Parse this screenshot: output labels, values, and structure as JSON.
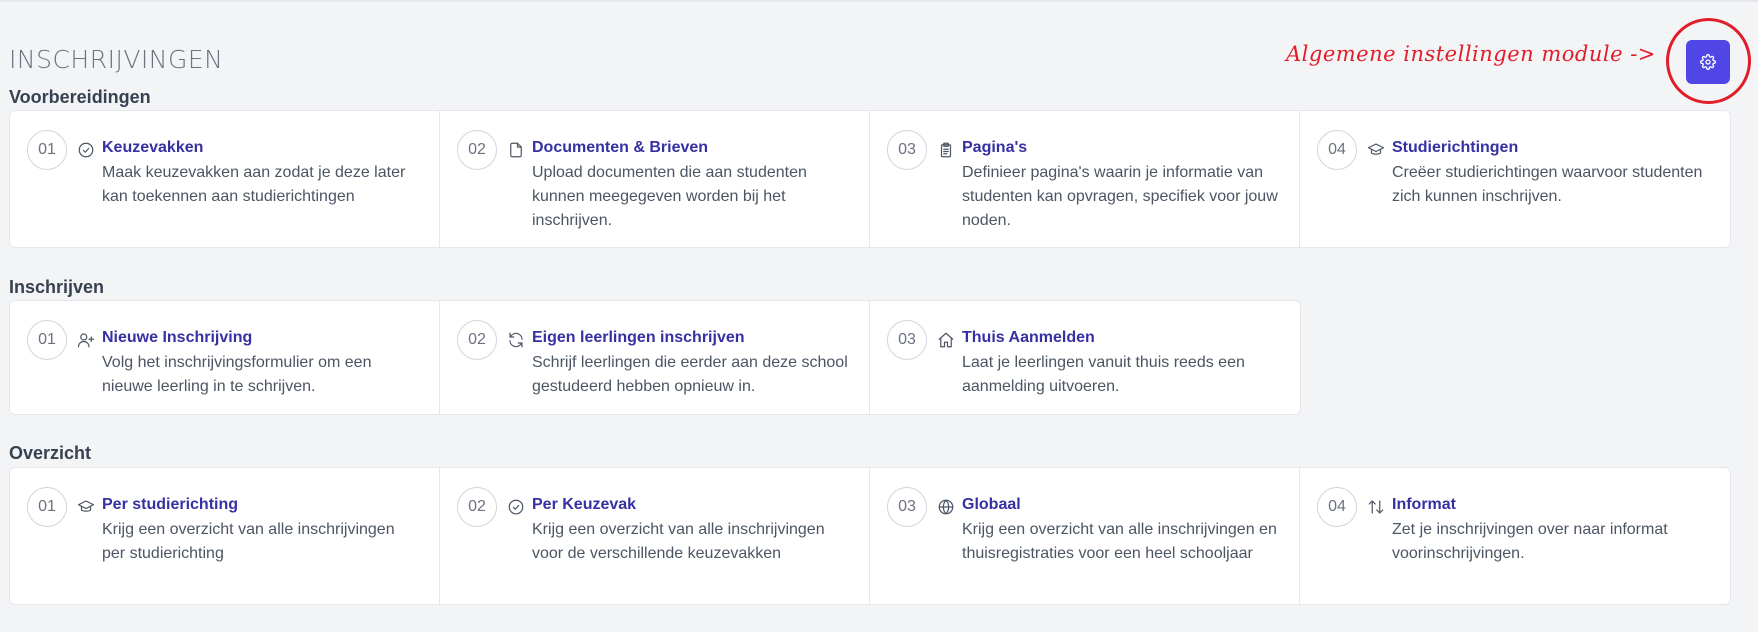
{
  "page": {
    "title": "INSCHRIJVINGEN"
  },
  "annotation": {
    "text": "Algemene instellingen module ->",
    "color": "#e11d2a"
  },
  "settings_button": {
    "icon": "gear-icon",
    "color": "#4f46e5"
  },
  "sections": [
    {
      "heading": "Voorbereidingen",
      "cards": [
        {
          "number": "01",
          "icon": "check-circle-icon",
          "title": "Keuzevakken",
          "description": "Maak keuzevakken aan zodat je deze later kan toekennen aan studierichtingen"
        },
        {
          "number": "02",
          "icon": "document-icon",
          "title": "Documenten & Brieven",
          "description": "Upload documenten die aan studenten kunnen meegegeven worden bij het inschrijven."
        },
        {
          "number": "03",
          "icon": "clipboard-icon",
          "title": "Pagina's",
          "description": "Definieer pagina's waarin je informatie van studenten kan opvragen, specifiek voor jouw noden."
        },
        {
          "number": "04",
          "icon": "graduation-cap-icon",
          "title": "Studierichtingen",
          "description": "Creëer studierichtingen waarvoor studenten zich kunnen inschrijven."
        }
      ]
    },
    {
      "heading": "Inschrijven",
      "cards": [
        {
          "number": "01",
          "icon": "user-plus-icon",
          "title": "Nieuwe Inschrijving",
          "description": "Volg het inschrijvingsformulier om een nieuwe leerling in te schrijven."
        },
        {
          "number": "02",
          "icon": "refresh-icon",
          "title": "Eigen leerlingen inschrijven",
          "description": "Schrijf leerlingen die eerder aan deze school gestudeerd hebben opnieuw in."
        },
        {
          "number": "03",
          "icon": "home-icon",
          "title": "Thuis Aanmelden",
          "description": "Laat je leerlingen vanuit thuis reeds een aanmelding uitvoeren."
        }
      ]
    },
    {
      "heading": "Overzicht",
      "cards": [
        {
          "number": "01",
          "icon": "graduation-cap-icon",
          "title": "Per studierichting",
          "description": "Krijg een overzicht van alle inschrijvingen per studierichting"
        },
        {
          "number": "02",
          "icon": "check-circle-icon",
          "title": "Per Keuzevak",
          "description": "Krijg een overzicht van alle inschrijvingen voor de verschillende keuzevakken"
        },
        {
          "number": "03",
          "icon": "globe-icon",
          "title": "Globaal",
          "description": "Krijg een overzicht van alle inschrijvingen en thuisregistraties voor een heel schooljaar"
        },
        {
          "number": "04",
          "icon": "arrows-up-down-icon",
          "title": "Informat",
          "description": "Zet je inschrijvingen over naar informat voorinschrijvingen."
        }
      ]
    }
  ]
}
